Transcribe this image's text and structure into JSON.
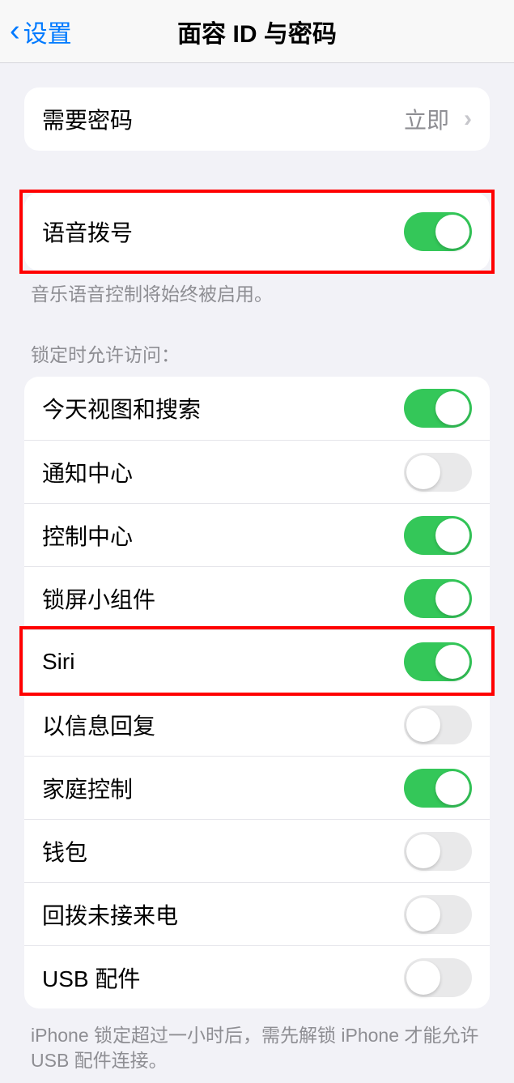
{
  "header": {
    "back_label": "设置",
    "title": "面容 ID 与密码"
  },
  "require_passcode": {
    "label": "需要密码",
    "value": "立即"
  },
  "voice_dial": {
    "label": "语音拨号",
    "enabled": true,
    "footer": "音乐语音控制将始终被启用。"
  },
  "lock_section": {
    "header": "锁定时允许访问：",
    "items": [
      {
        "label": "今天视图和搜索",
        "enabled": true
      },
      {
        "label": "通知中心",
        "enabled": false
      },
      {
        "label": "控制中心",
        "enabled": true
      },
      {
        "label": "锁屏小组件",
        "enabled": true
      },
      {
        "label": "Siri",
        "enabled": true
      },
      {
        "label": "以信息回复",
        "enabled": false
      },
      {
        "label": "家庭控制",
        "enabled": true
      },
      {
        "label": "钱包",
        "enabled": false
      },
      {
        "label": "回拨未接来电",
        "enabled": false
      },
      {
        "label": "USB 配件",
        "enabled": false
      }
    ],
    "footer": "iPhone 锁定超过一小时后，需先解锁 iPhone 才能允许 USB 配件连接。"
  },
  "highlights": [
    {
      "target": "voice-dial-row"
    },
    {
      "target": "siri-row"
    }
  ]
}
